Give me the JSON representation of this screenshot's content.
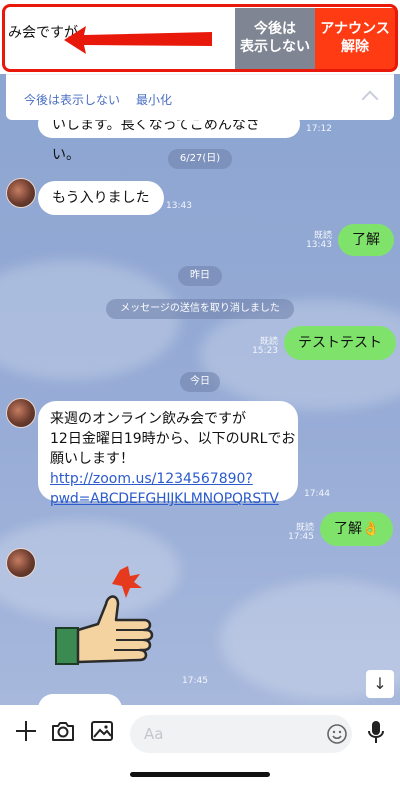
{
  "announcement": {
    "text": "み会ですが",
    "hide_label_1": "今後は",
    "hide_label_2": "表示しない",
    "cancel_label_1": "アナウンス",
    "cancel_label_2": "解除",
    "sub_hide": "今後は表示しない",
    "sub_minimize": "最小化"
  },
  "messages": {
    "m0_text": "いします。長くなってごめんなさい。",
    "m0_time": "17:12",
    "date_1": "6/27(日)",
    "m1_text": "もう入りました",
    "m1_time": "13:43",
    "m2_read": "既読",
    "m2_time": "13:43",
    "m2_text": "了解",
    "date_2": "昨日",
    "system": "メッセージの送信を取り消しました",
    "m3_read": "既読",
    "m3_time": "15:23",
    "m3_text": "テストテスト",
    "date_3": "今日",
    "m4_line1": "来週のオンライン飲み会ですが",
    "m4_line2": "12日金曜日19時から、以下のURLでお",
    "m4_line3": "願いします！",
    "m4_link1": "http://zoom.us/1234567890?",
    "m4_link2": "pwd=ABCDEFGHIJKLMNOPQRSTV",
    "m4_time": "17:44",
    "m5_read": "既読",
    "m5_time": "17:45",
    "m5_text": "了解👌",
    "m6_time": "17:45"
  },
  "input": {
    "placeholder": "Aa"
  },
  "icons": [
    "plus-icon",
    "camera-icon",
    "image-icon",
    "emoji-icon",
    "microphone-icon",
    "arrow-down-icon",
    "chevron-up-icon"
  ],
  "colors": {
    "accent_red": "#ff3b14",
    "bubble_green": "#7fe36b",
    "link_blue": "#2b5bcc"
  }
}
